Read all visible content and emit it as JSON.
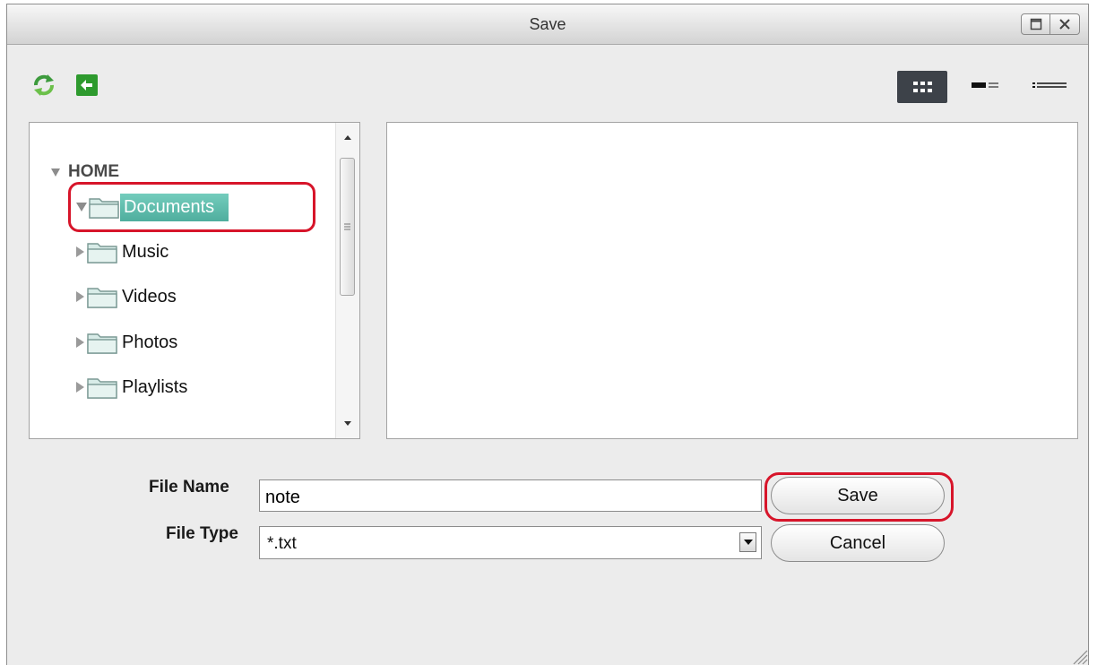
{
  "window": {
    "title": "Save"
  },
  "toolbar": {
    "icons": [
      "refresh-icon",
      "back-icon"
    ],
    "views": [
      "thumbnail-view",
      "detail-view",
      "list-view"
    ],
    "active_view": "thumbnail-view"
  },
  "tree": {
    "root": "HOME",
    "items": [
      {
        "label": "Documents",
        "expanded": true,
        "selected": true
      },
      {
        "label": "Music",
        "expanded": false,
        "selected": false
      },
      {
        "label": "Videos",
        "expanded": false,
        "selected": false
      },
      {
        "label": "Photos",
        "expanded": false,
        "selected": false
      },
      {
        "label": "Playlists",
        "expanded": false,
        "selected": false
      }
    ]
  },
  "form": {
    "file_name_label": "File Name",
    "file_name_value": "note",
    "file_type_label": "File Type",
    "file_type_value": "*.txt"
  },
  "buttons": {
    "save": "Save",
    "cancel": "Cancel"
  },
  "colors": {
    "selection": "#5dbcab",
    "highlight_ring": "#d7152a",
    "active_view_bg": "#3d4249",
    "refresh_icon": "#4aa34a",
    "back_icon": "#2e9a2e"
  }
}
